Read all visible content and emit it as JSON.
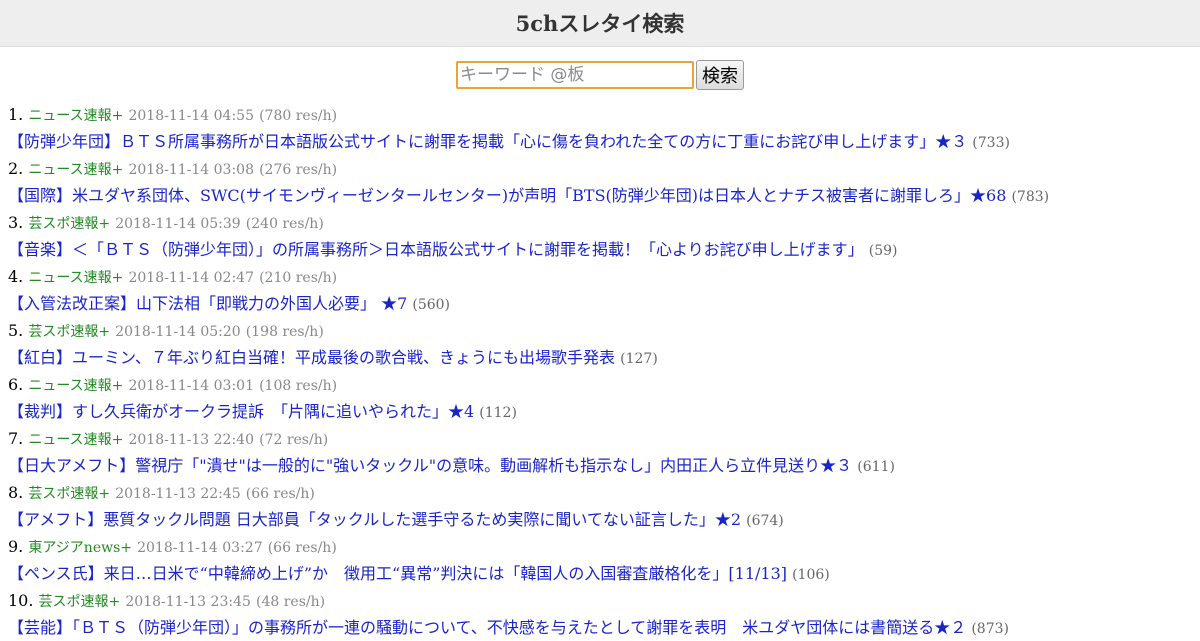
{
  "header": {
    "title": "5chスレタイ検索"
  },
  "search": {
    "placeholder": "キーワード @板",
    "value": "",
    "button_label": "検索"
  },
  "results": [
    {
      "rank": "1.",
      "board": "ニュース速報+",
      "datetime": "2018-11-14 04:55",
      "speed": "(780 res/h)",
      "title": "【防弾少年団】ＢＴＳ所属事務所が日本語版公式サイトに謝罪を掲載「心に傷を負われた全ての方に丁重にお詫び申し上げます」★３",
      "count": "(733)"
    },
    {
      "rank": "2.",
      "board": "ニュース速報+",
      "datetime": "2018-11-14 03:08",
      "speed": "(276 res/h)",
      "title": "【国際】米ユダヤ系団体、SWC(サイモンヴィーゼンタールセンター)が声明「BTS(防弾少年団)は日本人とナチス被害者に謝罪しろ」★68",
      "count": "(783)"
    },
    {
      "rank": "3.",
      "board": "芸スポ速報+",
      "datetime": "2018-11-14 05:39",
      "speed": "(240 res/h)",
      "title": "【音楽】＜「ＢＴＳ（防弾少年団）」の所属事務所＞日本語版公式サイトに謝罪を掲載！「心よりお詫び申し上げます」",
      "count": "(59)"
    },
    {
      "rank": "4.",
      "board": "ニュース速報+",
      "datetime": "2018-11-14 02:47",
      "speed": "(210 res/h)",
      "title": "【入管法改正案】山下法相「即戦力の外国人必要」 ★7",
      "count": "(560)"
    },
    {
      "rank": "5.",
      "board": "芸スポ速報+",
      "datetime": "2018-11-14 05:20",
      "speed": "(198 res/h)",
      "title": "【紅白】ユーミン、７年ぶり紅白当確！平成最後の歌合戦、きょうにも出場歌手発表",
      "count": "(127)"
    },
    {
      "rank": "6.",
      "board": "ニュース速報+",
      "datetime": "2018-11-14 03:01",
      "speed": "(108 res/h)",
      "title": "【裁判】すし久兵衛がオークラ提訴　「片隅に追いやられた」★4",
      "count": "(112)"
    },
    {
      "rank": "7.",
      "board": "ニュース速報+",
      "datetime": "2018-11-13 22:40",
      "speed": "(72 res/h)",
      "title": "【日大アメフト】警視庁「\"潰せ\"は一般的に\"強いタックル\"の意味。動画解析も指示なし」内田正人ら立件見送り★３",
      "count": "(611)"
    },
    {
      "rank": "8.",
      "board": "芸スポ速報+",
      "datetime": "2018-11-13 22:45",
      "speed": "(66 res/h)",
      "title": "【アメフト】悪質タックル問題 日大部員「タックルした選手守るため実際に聞いてない証言した」★2",
      "count": "(674)"
    },
    {
      "rank": "9.",
      "board": "東アジアnews+",
      "datetime": "2018-11-14 03:27",
      "speed": "(66 res/h)",
      "title": "【ペンス氏】来日…日米で“中韓締め上げ”か　徴用工“異常”判決には「韓国人の入国審査厳格化を」[11/13]",
      "count": "(106)"
    },
    {
      "rank": "10.",
      "board": "芸スポ速報+",
      "datetime": "2018-11-13 23:45",
      "speed": "(48 res/h)",
      "title": "【芸能】「ＢＴＳ（防弾少年団）」の事務所が一連の騒動について、不快感を与えたとして謝罪を表明　米ユダヤ団体には書簡送る★２",
      "count": "(873)"
    }
  ]
}
